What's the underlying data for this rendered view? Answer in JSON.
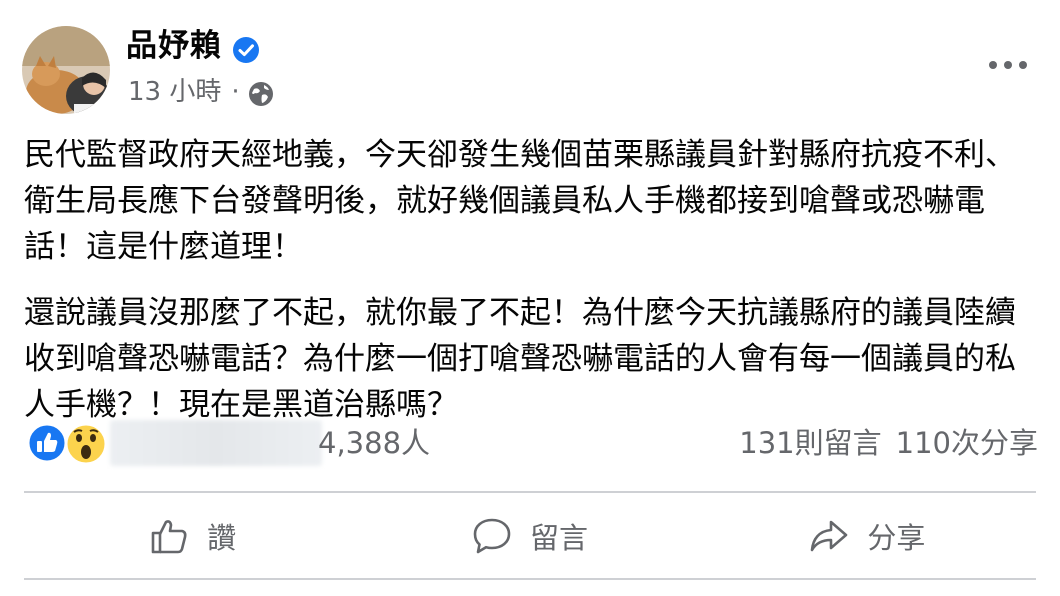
{
  "author": {
    "name": "品妤賴",
    "verified_icon": "verified-badge-icon",
    "time": "13 小時",
    "separator": "·",
    "privacy_icon": "globe-icon"
  },
  "post": {
    "paragraph_1": "民代監督政府天經地義，今天卻發生幾個苗栗縣議員針對縣府抗疫不利、衛生局長應下台發聲明後，就好幾個議員私人手機都接到嗆聲或恐嚇電話！這是什麼道理！",
    "paragraph_2": "還說議員沒那麼了不起，就你最了不起！為什麼今天抗議縣府的議員陸續收到嗆聲恐嚇電話？為什麼一個打嗆聲恐嚇電話的人會有每一個議員的私人手機？！現在是黑道治縣嗎？"
  },
  "stats": {
    "reaction_count": "4,388人",
    "comments": "131則留言",
    "shares": "110次分享"
  },
  "actions": {
    "like": "讚",
    "comment": "留言",
    "share": "分享"
  },
  "colors": {
    "verified_blue": "#1877f2",
    "secondary_text": "#65676b",
    "divider": "#ced0d4"
  }
}
